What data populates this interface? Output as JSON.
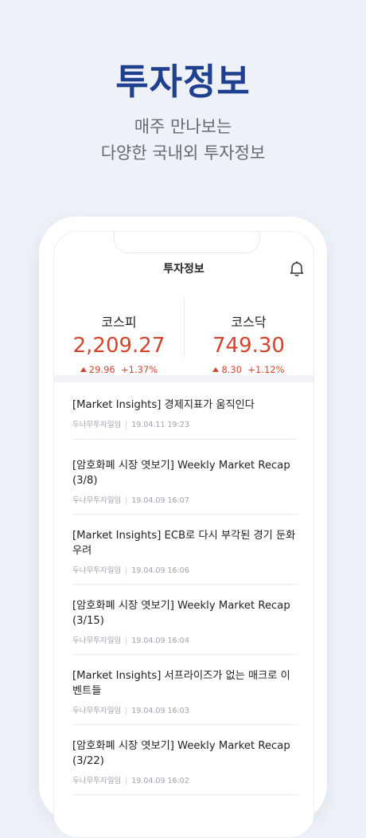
{
  "hero": {
    "title": "투자정보",
    "subtitle_line1": "매주 만나보는",
    "subtitle_line2": "다양한 국내외 투자정보"
  },
  "app": {
    "title": "투자정보",
    "bell_icon": "bell-icon"
  },
  "indices": [
    {
      "name": "코스피",
      "value": "2,209.27",
      "change": "29.96",
      "change_pct": "+1.37%"
    },
    {
      "name": "코스닥",
      "value": "749.30",
      "change": "8.30",
      "change_pct": "+1.12%"
    }
  ],
  "colors": {
    "up": "#d2452c",
    "brand": "#1f3f8f"
  },
  "news": [
    {
      "title": "[Market Insights] 경제지표가 움직인다",
      "source": "두나무투자일임",
      "date": "19.04.11 19:23"
    },
    {
      "title": "[암호화폐 시장 엿보기] Weekly Market Recap (3/8)",
      "source": "두나무투자일임",
      "date": "19.04.09 16:07"
    },
    {
      "title": "[Market Insights] ECB로 다시 부각된 경기 둔화 우려",
      "source": "두나무투자일임",
      "date": "19.04.09 16:06"
    },
    {
      "title": "[암호화폐 시장 엿보기] Weekly Market Recap (3/15)",
      "source": "두나무투자일임",
      "date": "19.04.09 16:04"
    },
    {
      "title": "[Market Insights] 서프라이즈가 없는 매크로 이벤트들",
      "source": "두나무투자일임",
      "date": "19.04.09 16:03"
    },
    {
      "title": "[암호화폐 시장 엿보기] Weekly Market Recap (3/22)",
      "source": "두나무투자일임",
      "date": "19.04.09 16:02"
    }
  ]
}
